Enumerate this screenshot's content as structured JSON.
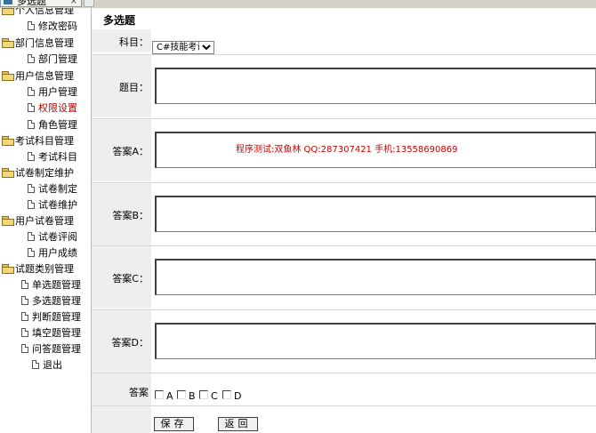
{
  "tab": {
    "title": "多选题",
    "close": "×"
  },
  "sidebar": {
    "items": [
      {
        "label": "个人信息管理",
        "type": "folder"
      },
      {
        "label": "修改密码",
        "type": "page"
      },
      {
        "label": "部门信息管理",
        "type": "folder"
      },
      {
        "label": "部门管理",
        "type": "page"
      },
      {
        "label": "用户信息管理",
        "type": "folder"
      },
      {
        "label": "用户管理",
        "type": "page"
      },
      {
        "label": "权限设置",
        "type": "page",
        "active": true
      },
      {
        "label": "角色管理",
        "type": "page"
      },
      {
        "label": "考试科目管理",
        "type": "folder"
      },
      {
        "label": "考试科目",
        "type": "page"
      },
      {
        "label": "试卷制定维护",
        "type": "folder"
      },
      {
        "label": "试卷制定",
        "type": "page"
      },
      {
        "label": "试卷维护",
        "type": "page"
      },
      {
        "label": "用户试卷管理",
        "type": "folder"
      },
      {
        "label": "试卷评阅",
        "type": "page"
      },
      {
        "label": "用户成绩",
        "type": "page"
      },
      {
        "label": "试题类别管理",
        "type": "folder"
      },
      {
        "label": "单选题管理",
        "type": "page"
      },
      {
        "label": "多选题管理",
        "type": "page"
      },
      {
        "label": "判断题管理",
        "type": "page"
      },
      {
        "label": "填空题管理",
        "type": "page"
      },
      {
        "label": "问答题管理",
        "type": "page"
      },
      {
        "label": "退出",
        "type": "page"
      }
    ]
  },
  "main": {
    "title": "多选题",
    "subject_label": "科目：",
    "subject_value": "C#技能考试",
    "question_label": "题目：",
    "answer_a_label": "答案A：",
    "answer_b_label": "答案B：",
    "answer_c_label": "答案C：",
    "answer_d_label": "答案D：",
    "credit": "程序测试:双鱼林 QQ:287307421 手机:13558690869",
    "answer_label": "答案",
    "options": [
      "A",
      "B",
      "C",
      "D"
    ],
    "save_label": "保存",
    "back_label": "返回"
  },
  "colors": {
    "credit": "#cc0000",
    "active_link": "#c00000",
    "label_bg": "#eeeeee"
  }
}
